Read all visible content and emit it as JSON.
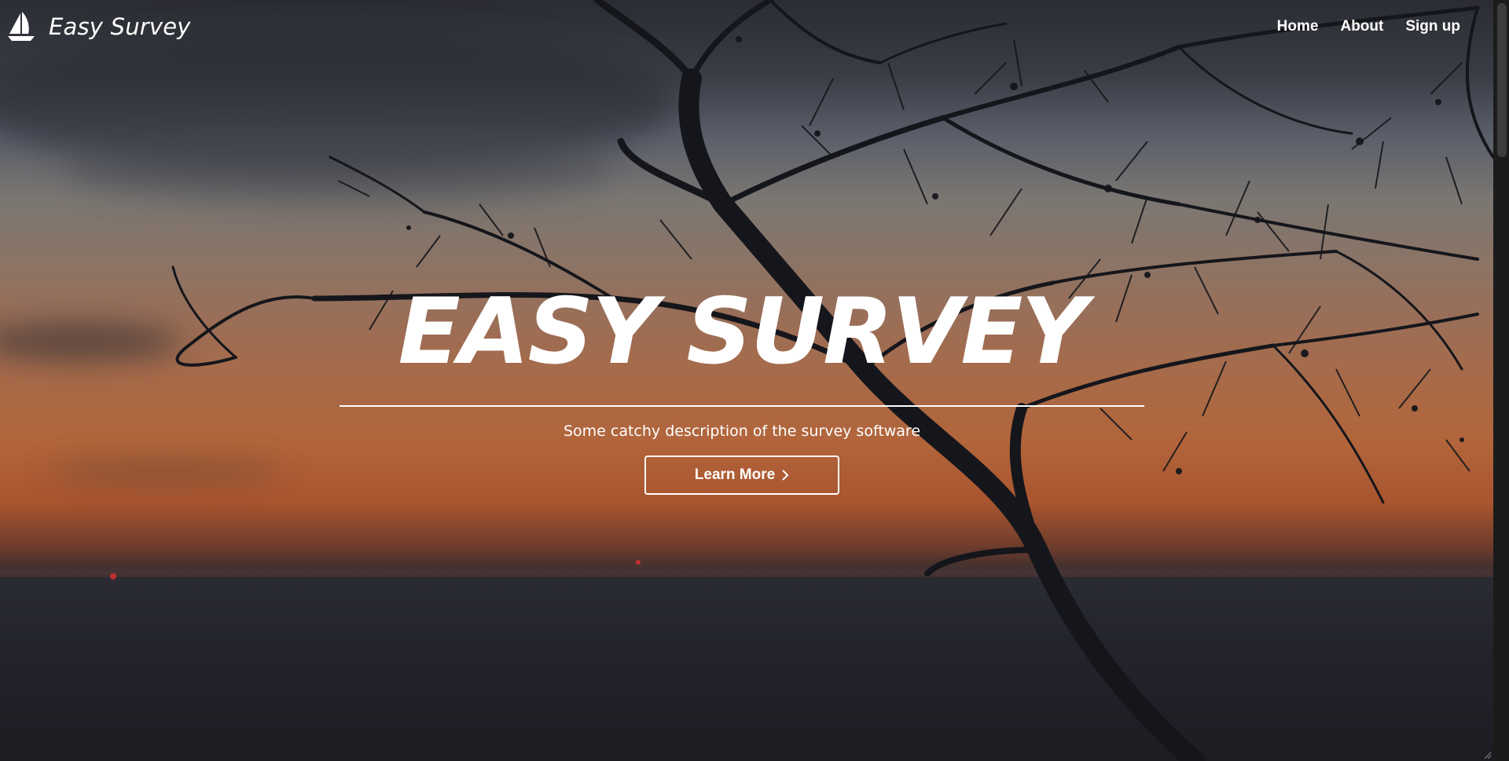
{
  "navbar": {
    "brand_name": "Easy Survey",
    "brand_icon": "sailboat-icon",
    "links": [
      {
        "label": "Home"
      },
      {
        "label": "About"
      },
      {
        "label": "Sign up"
      }
    ]
  },
  "hero": {
    "title": "EASY SURVEY",
    "subtitle": "Some catchy description of the survey software",
    "cta_label": "Learn More",
    "cta_icon": "chevron-right-icon"
  },
  "colors": {
    "text": "#ffffff",
    "sky_top": "#2b2c33",
    "sunset_orange": "#b2653b",
    "sea": "#1c1d23"
  }
}
